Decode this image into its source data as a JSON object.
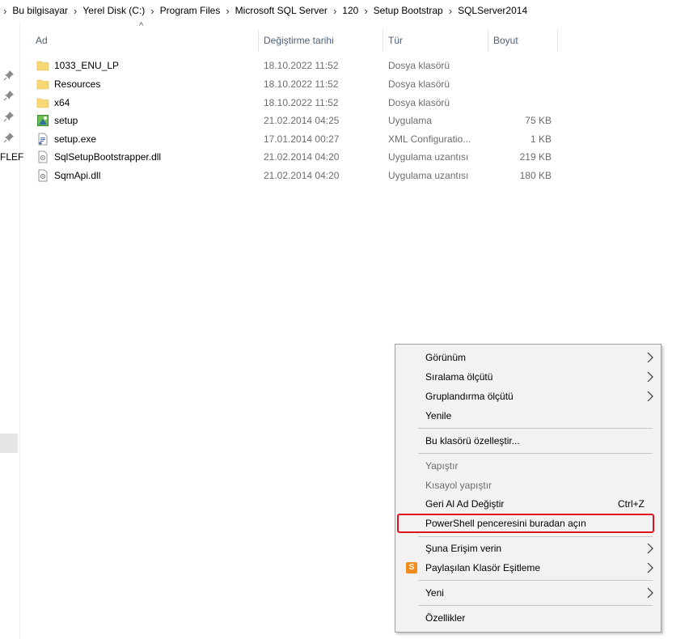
{
  "breadcrumb": [
    "Bu bilgisayar",
    "Yerel Disk (C:)",
    "Program Files",
    "Microsoft SQL Server",
    "120",
    "Setup Bootstrap",
    "SQLServer2014"
  ],
  "nav": {
    "fragment": "FLEF"
  },
  "columns": {
    "name": "Ad",
    "date": "Değiştirme tarihi",
    "type": "Tür",
    "size": "Boyut"
  },
  "sort_indicator": "^",
  "files": [
    {
      "name": "1033_ENU_LP",
      "date": "18.10.2022 11:52",
      "type": "Dosya klasörü",
      "size": "",
      "icon": "folder-icon"
    },
    {
      "name": "Resources",
      "date": "18.10.2022 11:52",
      "type": "Dosya klasörü",
      "size": "",
      "icon": "folder-icon"
    },
    {
      "name": "x64",
      "date": "18.10.2022 11:52",
      "type": "Dosya klasörü",
      "size": "",
      "icon": "folder-icon"
    },
    {
      "name": "setup",
      "date": "21.02.2014 04:25",
      "type": "Uygulama",
      "size": "75 KB",
      "icon": "setup-app-icon"
    },
    {
      "name": "setup.exe",
      "date": "17.01.2014 00:27",
      "type": "XML Configuratio...",
      "size": "1 KB",
      "icon": "config-file-icon"
    },
    {
      "name": "SqlSetupBootstrapper.dll",
      "date": "21.02.2014 04:20",
      "type": "Uygulama uzantısı",
      "size": "219 KB",
      "icon": "dll-file-icon"
    },
    {
      "name": "SqmApi.dll",
      "date": "21.02.2014 04:20",
      "type": "Uygulama uzantısı",
      "size": "180 KB",
      "icon": "dll-file-icon"
    }
  ],
  "context_menu": {
    "view": "Görünüm",
    "sort_by": "Sıralama ölçütü",
    "group_by": "Gruplandırma ölçütü",
    "refresh": "Yenile",
    "customize": "Bu klasörü özelleştir...",
    "paste": "Yapıştır",
    "paste_shortcut": "Kısayol yapıştır",
    "undo_rename": "Geri Al Ad Değiştir",
    "undo_shortcut": "Ctrl+Z",
    "powershell": "PowerShell penceresini buradan açın",
    "give_access": "Şuna Erişim verin",
    "sync_shared": "Paylaşılan Klasör Eşitleme",
    "sync_icon_letter": "S",
    "new": "Yeni",
    "properties": "Özellikler"
  },
  "colors": {
    "highlight_border": "#e0141e",
    "folder": "#f8d775",
    "header_text": "#4c607a"
  }
}
